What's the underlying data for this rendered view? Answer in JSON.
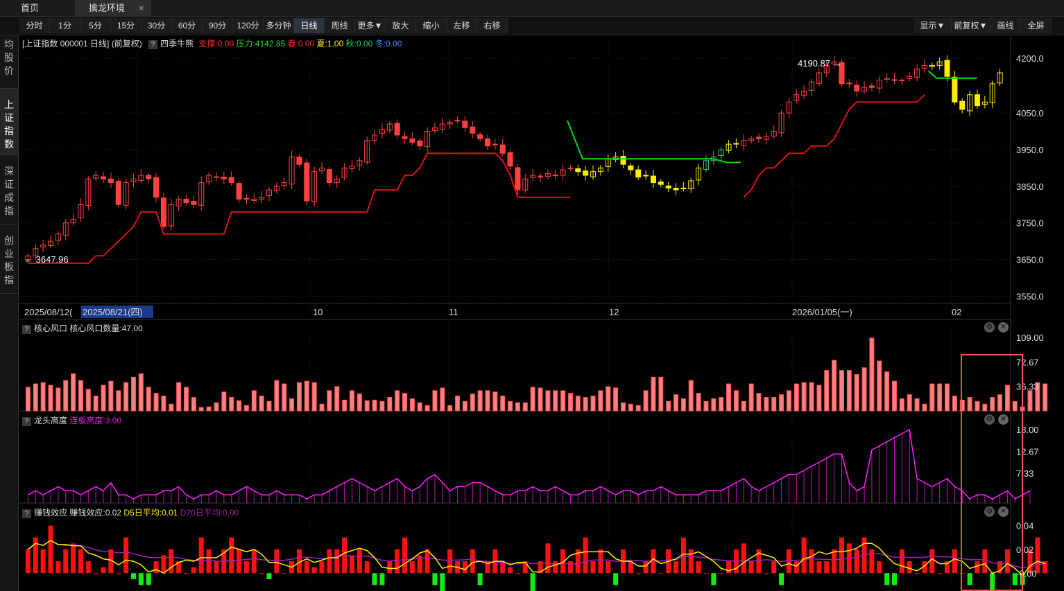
{
  "tabs": [
    {
      "label": "首页"
    },
    {
      "label": "擒龙环境",
      "close": "×"
    }
  ],
  "toolbar": {
    "periods": [
      "分时",
      "1分",
      "5分",
      "15分",
      "30分",
      "60分",
      "90分",
      "120分",
      "多分钟",
      "日线",
      "周线",
      "更多▼",
      "放大",
      "缩小",
      "左移",
      "右移"
    ],
    "active_period": "日线",
    "right_buttons": [
      "显示▼",
      "前复权▼",
      "画线",
      "全屏"
    ]
  },
  "sidebar": {
    "items": [
      {
        "label": "平均股价"
      },
      {
        "label": "上证指数",
        "active": true
      },
      {
        "label": "深证成指"
      },
      {
        "label": "创业板指"
      }
    ]
  },
  "main_panel": {
    "title": "[上证指数 000001 日线] (前复权)",
    "indicator": "四季牛熊",
    "support": "支撑:0.00",
    "pressure": "压力:4142.85",
    "spring": "春:0.00",
    "summer": "夏:1.00",
    "autumn": "秋:0.00",
    "winter": "冬:0.00",
    "high_label": "4190.87",
    "low_label": "3647.96",
    "y_ticks": [
      "4200.0",
      "4050.0",
      "3950.0",
      "3850.0",
      "3750.0",
      "3650.0",
      "3550.0"
    ],
    "x_labels": [
      "2025/08/12(",
      "2025/08/21(四)",
      "10",
      "11",
      "12",
      "2026/01/05(一)",
      "02"
    ],
    "colors": {
      "up": "#ff4040",
      "down_yellow": "#ffee00",
      "down_green": "#40c080",
      "support": "#e01010",
      "pressure": "#00dd00"
    }
  },
  "panel2": {
    "title": "核心风口",
    "value": "核心风口数量:47.00",
    "y_ticks": [
      "109.00",
      "72.67",
      "36.33"
    ]
  },
  "panel3": {
    "title": "龙头高度",
    "value": "连板高度:3.00",
    "y_ticks": [
      "18.00",
      "12.67",
      "7.33"
    ]
  },
  "panel4": {
    "title": "赚钱效应",
    "value": "赚钱效应:0.02",
    "d5": "D5日平均:0.01",
    "d20": "D20日平均:0.00",
    "y_ticks": [
      "0.04",
      "0.02",
      "-0.00"
    ]
  },
  "chart_data": [
    {
      "type": "candlestick",
      "title": "[上证指数 000001 日线] (前复权)",
      "ylim": [
        3530,
        4230
      ],
      "y_ticks": [
        4200.0,
        4050.0,
        3950.0,
        3850.0,
        3650.0,
        3550.0,
        3750.0
      ],
      "closes": [
        3660,
        3680,
        3690,
        3700,
        3720,
        3750,
        3760,
        3800,
        3870,
        3880,
        3870,
        3860,
        3800,
        3860,
        3870,
        3880,
        3870,
        3820,
        3740,
        3800,
        3815,
        3805,
        3800,
        3860,
        3880,
        3875,
        3870,
        3860,
        3815,
        3815,
        3815,
        3820,
        3840,
        3850,
        3860,
        3930,
        3910,
        3810,
        3890,
        3900,
        3860,
        3870,
        3900,
        3905,
        3920,
        3975,
        3990,
        4005,
        4020,
        3990,
        3980,
        3970,
        3960,
        4000,
        4010,
        4020,
        4025,
        4030,
        4010,
        3995,
        3980,
        3960,
        3965,
        3940,
        3905,
        3840,
        3870,
        3880,
        3875,
        3885,
        3880,
        3895,
        3900,
        3890,
        3880,
        3890,
        3900,
        3925,
        3930,
        3910,
        3895,
        3875,
        3880,
        3860,
        3855,
        3845,
        3840,
        3845,
        3865,
        3900,
        3920,
        3930,
        3950,
        3965,
        3965,
        3975,
        3980,
        3980,
        3985,
        4000,
        4050,
        4080,
        4100,
        4110,
        4135,
        4160,
        4180,
        4190,
        4130,
        4130,
        4110,
        4120,
        4120,
        4140,
        4145,
        4140,
        4140,
        4150,
        4170,
        4180,
        4180,
        4190,
        4150,
        4080,
        4060,
        4100,
        4070,
        4080,
        4130,
        4160
      ],
      "support_line": "red stepped trailing line",
      "pressure_line": "green stepped line"
    },
    {
      "type": "bar",
      "title": "核心风口",
      "ylim": [
        0,
        109
      ],
      "values": [
        35,
        40,
        42,
        38,
        34,
        45,
        55,
        45,
        32,
        22,
        38,
        44,
        30,
        42,
        50,
        55,
        35,
        26,
        22,
        10,
        42,
        35,
        20,
        5,
        6,
        12,
        28,
        20,
        15,
        8,
        30,
        22,
        14,
        45,
        40,
        18,
        42,
        44,
        42,
        10,
        30,
        36,
        16,
        30,
        25,
        15,
        16,
        14,
        20,
        30,
        26,
        18,
        12,
        8,
        30,
        34,
        8,
        22,
        14,
        25,
        30,
        30,
        28,
        22,
        14,
        12,
        12,
        35,
        34,
        30,
        30,
        30,
        26,
        22,
        20,
        22,
        30,
        36,
        34,
        12,
        10,
        8,
        30,
        50,
        50,
        14,
        24,
        18,
        45,
        26,
        14,
        18,
        20,
        40,
        30,
        14,
        40,
        26,
        20,
        20,
        24,
        30,
        40,
        42,
        42,
        38,
        60,
        75,
        60,
        60,
        54,
        64,
        108,
        74,
        58,
        44,
        18,
        24,
        18,
        10,
        40,
        40,
        40,
        22,
        16,
        20,
        14,
        10,
        20,
        24,
        38,
        14,
        6,
        30,
        42,
        40
      ]
    },
    {
      "type": "line",
      "title": "龙头高度",
      "ylim": [
        0,
        18
      ],
      "values": [
        2,
        3,
        2,
        3,
        4,
        3,
        3,
        2,
        3,
        4,
        3,
        5,
        2,
        2,
        1,
        2,
        2,
        2,
        3,
        3,
        4,
        2,
        1,
        2,
        2,
        3,
        2,
        2,
        3,
        4,
        3,
        2,
        2,
        3,
        2,
        2,
        2,
        1,
        2,
        2,
        3,
        4,
        5,
        6,
        5,
        4,
        3,
        4,
        5,
        6,
        4,
        3,
        4,
        6,
        7,
        5,
        3,
        4,
        4,
        5,
        5,
        4,
        3,
        2,
        2,
        3,
        3,
        4,
        3,
        3,
        4,
        3,
        2,
        2,
        3,
        3,
        4,
        3,
        2,
        3,
        3,
        2,
        3,
        3,
        4,
        3,
        2,
        2,
        2,
        2,
        3,
        3,
        3,
        4,
        5,
        6,
        4,
        3,
        4,
        5,
        6,
        7,
        7,
        8,
        9,
        10,
        11,
        12,
        12,
        5,
        3,
        4,
        13,
        14,
        15,
        16,
        17,
        18,
        6,
        5,
        4,
        5,
        6,
        4,
        3,
        1,
        2,
        2,
        1,
        2,
        3,
        1,
        2,
        3
      ]
    },
    {
      "type": "bar",
      "title": "赚钱效应",
      "ylim": [
        -0.015,
        0.045
      ],
      "series_names": [
        "赚钱效应",
        "D5日平均",
        "D20日平均"
      ],
      "values": [
        0.02,
        0.03,
        0.02,
        0.04,
        0.01,
        0.02,
        0.025,
        0.02,
        0.01,
        0.0,
        0.005,
        0.02,
        0.0,
        0.03,
        -0.005,
        -0.01,
        -0.01,
        0.01,
        0.015,
        0.02,
        0.01,
        0.0,
        0.005,
        0.03,
        0.02,
        0.01,
        0.02,
        0.03,
        0.02,
        0.01,
        0.02,
        0.0,
        -0.005,
        0.02,
        0.0,
        0.01,
        0.02,
        0.01,
        0.005,
        0.01,
        0.02,
        0.02,
        0.03,
        0.015,
        0.02,
        0.01,
        -0.01,
        -0.01,
        0.01,
        0.02,
        0.03,
        0.01,
        0.015,
        0.02,
        -0.01,
        -0.015,
        0.02,
        0.01,
        0.01,
        0.02,
        -0.01,
        0.01,
        0.02,
        0.01,
        0.005,
        0.0,
        0.01,
        -0.02,
        0.01,
        0.025,
        0.01,
        0.02,
        0.01,
        0.02,
        0.03,
        0.01,
        0.02,
        0.01,
        -0.01,
        0.02,
        0.01,
        0.0,
        0.01,
        0.02,
        0.0,
        0.02,
        0.01,
        0.03,
        0.02,
        0.01,
        0.0,
        -0.01,
        0.0,
        0.01,
        0.02,
        0.025,
        0.01,
        0.02,
        0.0,
        0.01,
        -0.01,
        0.02,
        0.01,
        0.03,
        0.02,
        0.01,
        0.01,
        0.02,
        0.03,
        0.025,
        0.02,
        0.03,
        0.02,
        0.01,
        -0.01,
        -0.01,
        0.02,
        0.01,
        0.0,
        0.01,
        0.02,
        0.0,
        0.01,
        0.02,
        0.0,
        -0.01,
        0.01,
        0.02,
        -0.02,
        0.01,
        0.02,
        -0.01,
        -0.01,
        0.02,
        0.03,
        0.01
      ]
    }
  ]
}
